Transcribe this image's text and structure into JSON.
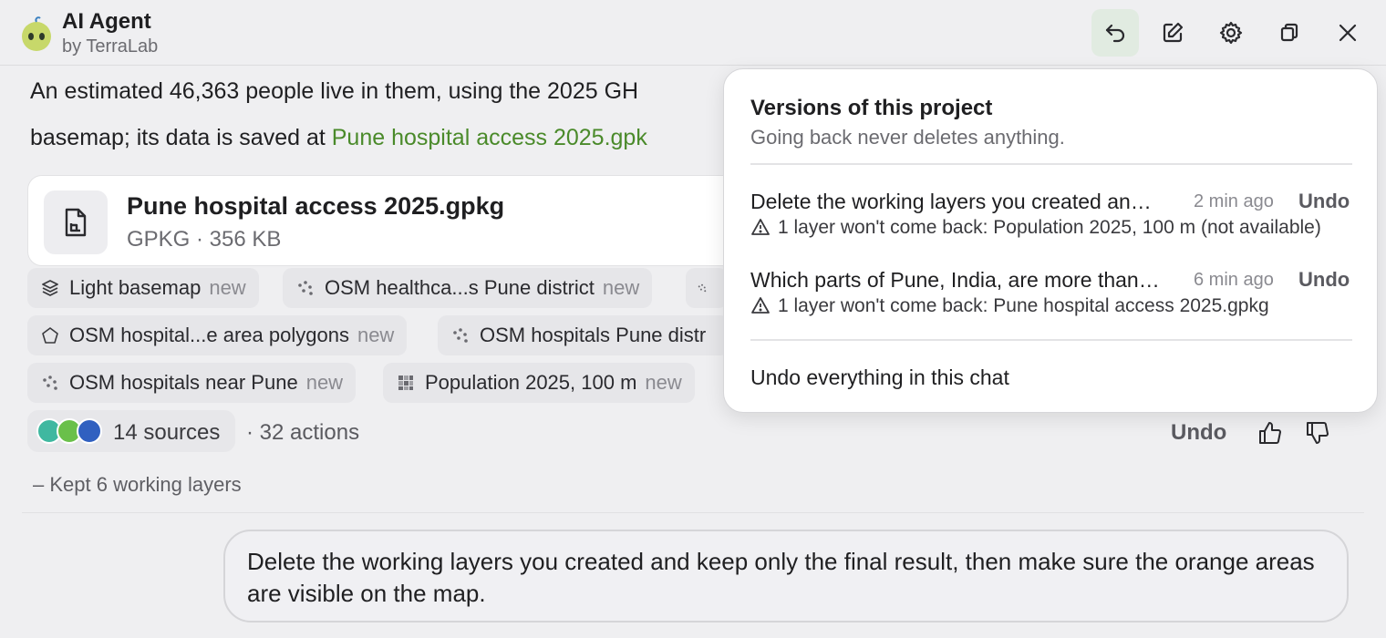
{
  "app": {
    "title": "AI Agent",
    "subtitle": "by TerraLab"
  },
  "header_buttons": [
    {
      "name": "undo-icon"
    },
    {
      "name": "edit-icon"
    },
    {
      "name": "gear-icon"
    },
    {
      "name": "copy-window-icon"
    },
    {
      "name": "close-icon"
    }
  ],
  "message": {
    "line1": "An estimated 46,363 people live in them, using the 2025 GH",
    "line2_prefix": "basemap; its data is saved at ",
    "line2_link": "Pune hospital access 2025.gpk"
  },
  "file": {
    "name": "Pune hospital access 2025.gpkg",
    "meta": "GPKG · 356 KB"
  },
  "chips": [
    {
      "label": "Light basemap",
      "tag": "new",
      "icon": "layers-icon"
    },
    {
      "label": "OSM healthca...s Pune district",
      "tag": "new",
      "icon": "points-icon"
    },
    {
      "label": "OSM hospital...e area polygons",
      "tag": "new",
      "icon": "polygon-icon"
    },
    {
      "label": "OSM hospitals Pune distr",
      "tag": "",
      "icon": "points-icon"
    },
    {
      "label": "OSM hospitals near Pune",
      "tag": "new",
      "icon": "points-icon"
    },
    {
      "label": "Population 2025, 100 m",
      "tag": "new",
      "icon": "raster-icon"
    }
  ],
  "sources": {
    "label": "14 sources",
    "actions": "· 32 actions"
  },
  "feedback": {
    "undo": "Undo"
  },
  "kept": "–   Kept 6 working layers",
  "user_message": "Delete the working layers you created and keep only the final result, then make sure the orange areas are visible on the map.",
  "versions": {
    "title": "Versions of this project",
    "subtitle": "Going back never deletes anything.",
    "items": [
      {
        "title": "Delete the working layers you created and keep only the final result",
        "time": "2 min ago",
        "undo": "Undo",
        "warning": "1 layer won't come back: Population 2025, 100 m (not available)"
      },
      {
        "title": "Which parts of Pune, India, are more than a certain distance away",
        "time": "6 min ago",
        "undo": "Undo",
        "warning": "1 layer won't come back: Pune hospital access 2025.gpkg"
      }
    ],
    "undo_all": "Undo everything in this chat"
  },
  "colors": {
    "accent_green": "#4a8a2a",
    "active_button_bg": "#e1ebe1"
  }
}
